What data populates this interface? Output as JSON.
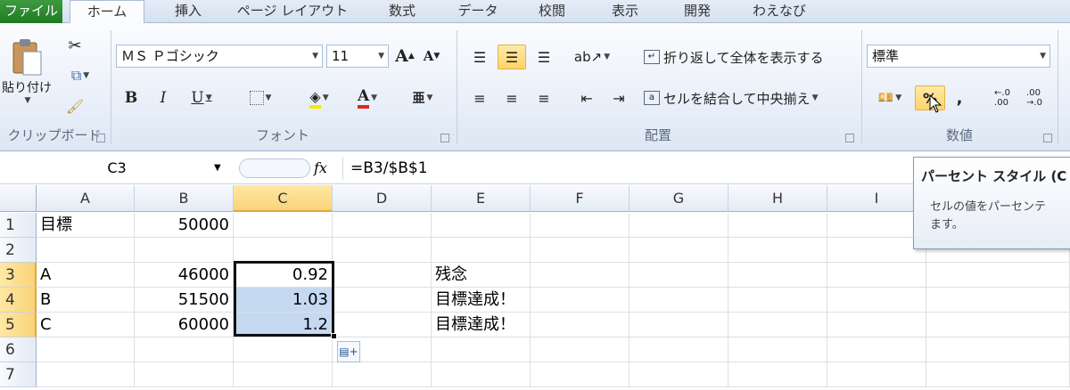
{
  "ribbon": {
    "tabs": [
      "ファイル",
      "ホーム",
      "挿入",
      "ページ レイアウト",
      "数式",
      "データ",
      "校閲",
      "表示",
      "開発",
      "わえなび"
    ],
    "clipboard": {
      "paste_label": "貼り付け",
      "group_label": "クリップボード"
    },
    "font": {
      "name": "ＭＳ Ｐゴシック",
      "size": "11",
      "grow": "A",
      "shrink": "A",
      "bold": "B",
      "italic": "I",
      "underline": "U",
      "group_label": "フォント"
    },
    "alignment": {
      "wrap_label": "折り返して全体を表示する",
      "merge_label": "セルを結合して中央揃え",
      "group_label": "配置"
    },
    "number": {
      "format": "標準",
      "group_label": "数値",
      "percent": "%",
      "comma": ","
    }
  },
  "formula_bar": {
    "name_box": "C3",
    "fx": "fx",
    "formula": "=B3/$B$1"
  },
  "grid": {
    "columns": [
      "A",
      "B",
      "C",
      "D",
      "E",
      "F",
      "G",
      "H",
      "I"
    ],
    "rows": [
      {
        "num": "1",
        "A": "目標",
        "B": "50000",
        "C": "",
        "E": ""
      },
      {
        "num": "2",
        "A": "",
        "B": "",
        "C": "",
        "E": ""
      },
      {
        "num": "3",
        "A": "A",
        "B": "46000",
        "C": "0.92",
        "E": "残念"
      },
      {
        "num": "4",
        "A": "B",
        "B": "51500",
        "C": "1.03",
        "E": "目標達成！"
      },
      {
        "num": "5",
        "A": "C",
        "B": "60000",
        "C": "1.2",
        "E": "目標達成！"
      },
      {
        "num": "6",
        "A": "",
        "B": "",
        "C": "",
        "E": ""
      },
      {
        "num": "7",
        "A": "",
        "B": "",
        "C": "",
        "E": ""
      }
    ]
  },
  "tooltip": {
    "title": "パーセント スタイル (C",
    "body_line1": "セルの値をパーセンテ",
    "body_line2": "ます。"
  },
  "colors": {
    "accent": "#1e7a23",
    "selection": "#c5d9f1",
    "header_selected": "#f9d37a"
  }
}
